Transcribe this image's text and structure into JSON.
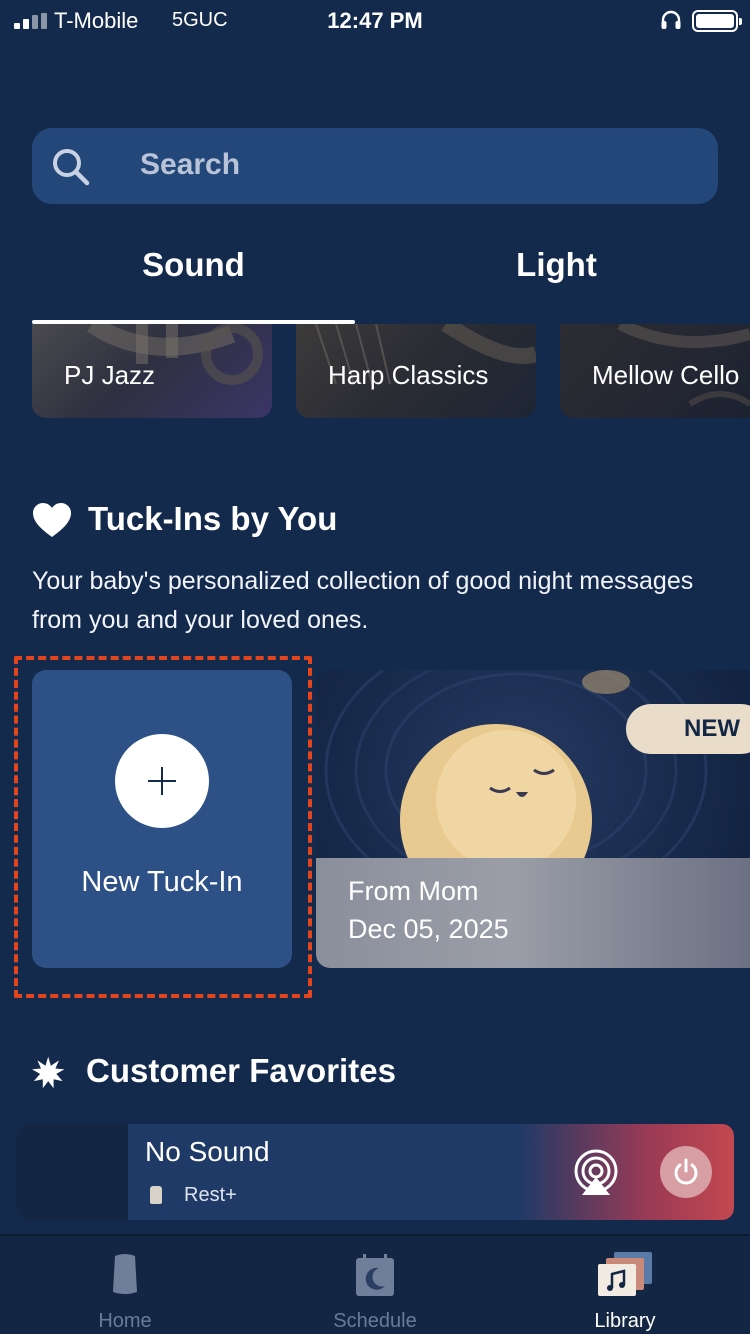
{
  "status_bar": {
    "carrier": "T-Mobile",
    "network": "5GUC",
    "time": "12:47 PM"
  },
  "search": {
    "placeholder": "Search"
  },
  "tabs": [
    {
      "label": "Sound",
      "selected": true
    },
    {
      "label": "Light",
      "selected": false
    }
  ],
  "playlists": [
    {
      "label": "PJ Jazz"
    },
    {
      "label": "Harp Classics"
    },
    {
      "label": "Mellow Cello"
    }
  ],
  "tuck_ins": {
    "title": "Tuck-Ins by You",
    "description": "Your baby's personalized collection of good night messages from you and your loved ones.",
    "new_label": "New Tuck-In",
    "items": [
      {
        "from": "From Mom",
        "date": "Dec 05, 2025",
        "badge": "NEW"
      }
    ]
  },
  "customer_favorites": {
    "title": "Customer Favorites"
  },
  "player": {
    "title": "No Sound",
    "device": "Rest+"
  },
  "bottom_nav": [
    {
      "label": "Home",
      "active": false
    },
    {
      "label": "Schedule",
      "active": false
    },
    {
      "label": "Library",
      "active": true
    }
  ],
  "colors": {
    "background": "#142a4d",
    "surface": "#24477a",
    "new_tuck_card": "#2d5186",
    "highlight": "#e2451d",
    "badge": "#e9ddc9"
  }
}
